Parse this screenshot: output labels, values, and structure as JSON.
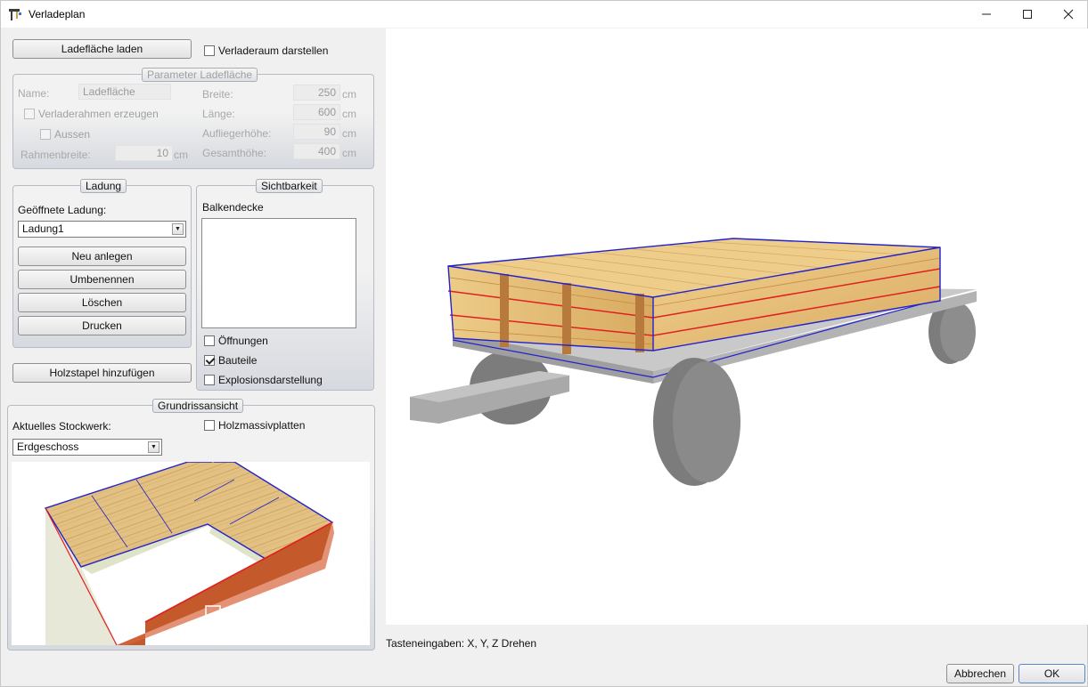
{
  "window": {
    "title": "Verladeplan"
  },
  "top": {
    "load_button": "Ladefläche laden",
    "show_loading_space": {
      "label": "Verladeraum darstellen",
      "checked": false
    }
  },
  "parameter": {
    "title": "Parameter Ladefläche",
    "name_label": "Name:",
    "name_value": "Ladefläche",
    "frame_checkbox": "Verladerahmen erzeugen",
    "outside_checkbox": "Aussen",
    "frame_width_label": "Rahmenbreite:",
    "frame_width_value": "10",
    "frame_width_unit": "cm",
    "width_label": "Breite:",
    "width_value": "250",
    "length_label": "Länge:",
    "length_value": "600",
    "trailer_height_label": "Aufliegerhöhe:",
    "trailer_height_value": "90",
    "total_height_label": "Gesamthöhe:",
    "total_height_value": "400",
    "unit": "cm"
  },
  "ladung": {
    "title": "Ladung",
    "opened_label": "Geöffnete Ladung:",
    "selected": "Ladung1",
    "new_button": "Neu anlegen",
    "rename_button": "Umbenennen",
    "delete_button": "Löschen",
    "print_button": "Drucken"
  },
  "sichtbarkeit": {
    "title": "Sichtbarkeit",
    "list_label": "Balkendecke",
    "openings": {
      "label": "Öffnungen",
      "checked": false
    },
    "components": {
      "label": "Bauteile",
      "checked": true
    },
    "explosion": {
      "label": "Explosionsdarstellung",
      "checked": false
    }
  },
  "add_stack_button": "Holzstapel hinzufügen",
  "grundriss": {
    "title": "Grundrissansicht",
    "floor_label": "Aktuelles Stockwerk:",
    "floor_selected": "Erdgeschoss",
    "clt": {
      "label": "Holzmassivplatten",
      "checked": false
    }
  },
  "status": "Tasteneingaben: X, Y, Z Drehen",
  "footer": {
    "cancel_button": "Abbrechen",
    "ok_button": "OK"
  },
  "colors": {
    "wood": "#e6be7a",
    "wood_dark": "#b87a3c",
    "outline_blue": "#2222cc",
    "outline_red": "#e02020",
    "trailer_gray": "#a9a9a9",
    "wheel_gray": "#7c7c7c"
  }
}
